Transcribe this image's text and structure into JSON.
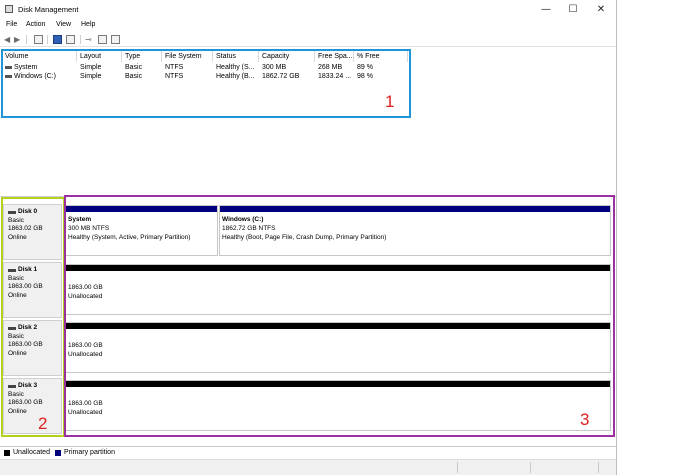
{
  "window": {
    "title": "Disk Management",
    "controls": {
      "minimize": "—",
      "maximize": "☐",
      "close": "✕"
    }
  },
  "menu": [
    "File",
    "Action",
    "View",
    "Help"
  ],
  "toolbar": {
    "back_icon": "arrow-left-icon",
    "forward_icon": "arrow-right-icon"
  },
  "volume_table": {
    "columns": [
      "Volume",
      "Layout",
      "Type",
      "File System",
      "Status",
      "Capacity",
      "Free Spa...",
      "% Free"
    ],
    "rows": [
      [
        "System",
        "Simple",
        "Basic",
        "NTFS",
        "Healthy (S...",
        "300 MB",
        "268 MB",
        "89 %"
      ],
      [
        "Windows (C:)",
        "Simple",
        "Basic",
        "NTFS",
        "Healthy (B...",
        "1862.72 GB",
        "1833.24 ...",
        "98 %"
      ]
    ]
  },
  "disks": [
    {
      "name": "Disk 0",
      "type": "Basic",
      "size": "1863.02 GB",
      "status": "Online"
    },
    {
      "name": "Disk 1",
      "type": "Basic",
      "size": "1863.00 GB",
      "status": "Online"
    },
    {
      "name": "Disk 2",
      "type": "Basic",
      "size": "1863.00 GB",
      "status": "Online"
    },
    {
      "name": "Disk 3",
      "type": "Basic",
      "size": "1863.00 GB",
      "status": "Online"
    }
  ],
  "partitions": {
    "disk0": [
      {
        "name": "System",
        "size": "300 MB NTFS",
        "status": "Healthy (System, Active, Primary Partition)"
      },
      {
        "name": "Windows  (C:)",
        "size": "1862.72 GB NTFS",
        "status": "Healthy (Boot, Page File, Crash Dump, Primary Partition)"
      }
    ],
    "disk1": {
      "size": "1863.00 GB",
      "status": "Unallocated"
    },
    "disk2": {
      "size": "1863.00 GB",
      "status": "Unallocated"
    },
    "disk3": {
      "size": "1863.00 GB",
      "status": "Unallocated"
    }
  },
  "legend": {
    "unallocated": "Unallocated",
    "primary": "Primary partition"
  },
  "annotations": {
    "one": "1",
    "two": "2",
    "three": "3"
  },
  "colors": {
    "primary_partition": "#00007f",
    "unallocated": "#000000",
    "annotation_1": "#1f94d6",
    "annotation_2": "#b2d31e",
    "annotation_3": "#9b30a0",
    "annotation_text": "#e02020"
  }
}
